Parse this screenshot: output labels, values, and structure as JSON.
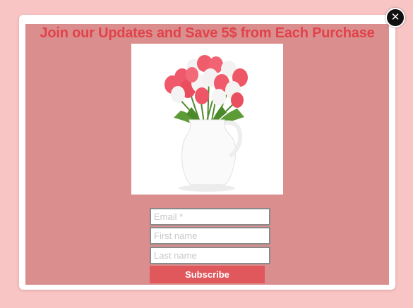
{
  "popup": {
    "headline": "Join our Updates and Save 5$ from Each Purchase",
    "close_symbol": "✕",
    "image_icon": "tulip-vase-icon",
    "colors": {
      "page_background": "#f9c4c4",
      "panel_background": "#db8e8e",
      "headline": "#e0434b",
      "button": "#e0575c"
    }
  },
  "form": {
    "email_placeholder": "Email *",
    "first_name_placeholder": "First name",
    "last_name_placeholder": "Last name",
    "subscribe_label": "Subscribe"
  }
}
